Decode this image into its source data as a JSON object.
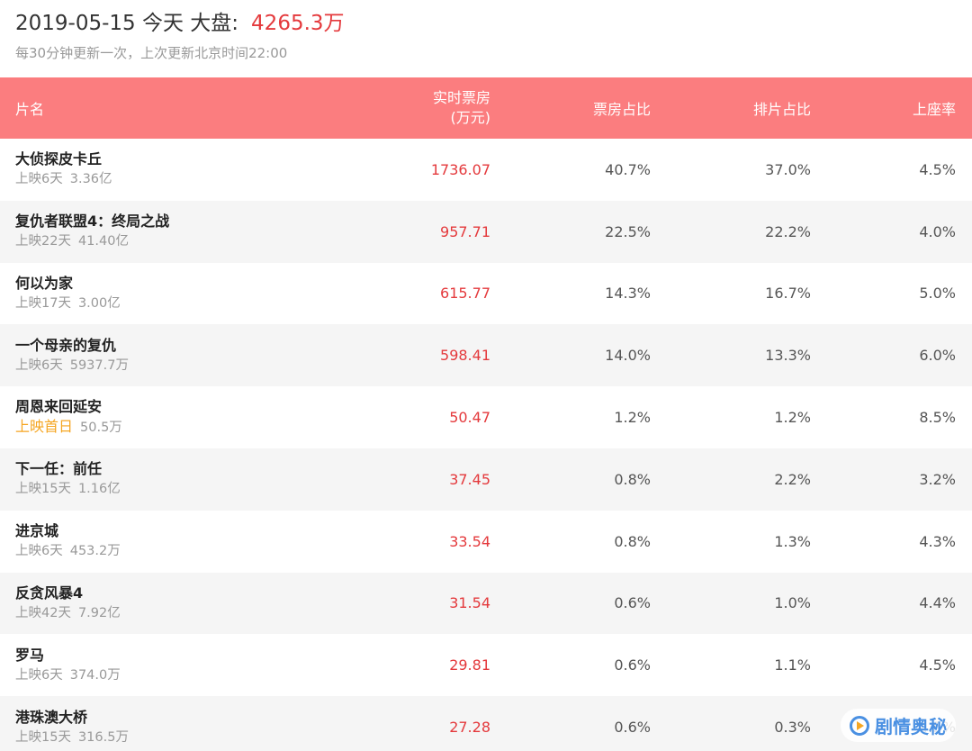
{
  "header": {
    "date_label": "2019-05-15 今天 大盘:",
    "total": "4265.3万",
    "update_note": "每30分钟更新一次，上次更新北京时间22:00"
  },
  "table": {
    "columns": {
      "name": "片名",
      "realtime_line1": "实时票房",
      "realtime_line2": "(万元)",
      "box_share": "票房占比",
      "show_share": "排片占比",
      "occupancy": "上座率"
    },
    "rows": [
      {
        "name": "大侦探皮卡丘",
        "days": "上映6天",
        "total": "3.36亿",
        "realtime": "1736.07",
        "box_share": "40.7%",
        "show_share": "37.0%",
        "occupancy": "4.5%"
      },
      {
        "name": "复仇者联盟4：终局之战",
        "days": "上映22天",
        "total": "41.40亿",
        "realtime": "957.71",
        "box_share": "22.5%",
        "show_share": "22.2%",
        "occupancy": "4.0%"
      },
      {
        "name": "何以为家",
        "days": "上映17天",
        "total": "3.00亿",
        "realtime": "615.77",
        "box_share": "14.3%",
        "show_share": "16.7%",
        "occupancy": "5.0%"
      },
      {
        "name": "一个母亲的复仇",
        "days": "上映6天",
        "total": "5937.7万",
        "realtime": "598.41",
        "box_share": "14.0%",
        "show_share": "13.3%",
        "occupancy": "6.0%"
      },
      {
        "name": "周恩来回延安",
        "days": "上映首日",
        "total": "50.5万",
        "realtime": "50.47",
        "box_share": "1.2%",
        "show_share": "1.2%",
        "occupancy": "8.5%"
      },
      {
        "name": "下一任：前任",
        "days": "上映15天",
        "total": "1.16亿",
        "realtime": "37.45",
        "box_share": "0.8%",
        "show_share": "2.2%",
        "occupancy": "3.2%"
      },
      {
        "name": "进京城",
        "days": "上映6天",
        "total": "453.2万",
        "realtime": "33.54",
        "box_share": "0.8%",
        "show_share": "1.3%",
        "occupancy": "4.3%"
      },
      {
        "name": "反贪风暴4",
        "days": "上映42天",
        "total": "7.92亿",
        "realtime": "31.54",
        "box_share": "0.6%",
        "show_share": "1.0%",
        "occupancy": "4.4%"
      },
      {
        "name": "罗马",
        "days": "上映6天",
        "total": "374.0万",
        "realtime": "29.81",
        "box_share": "0.6%",
        "show_share": "1.1%",
        "occupancy": "4.5%"
      },
      {
        "name": "港珠澳大桥",
        "days": "上映15天",
        "total": "316.5万",
        "realtime": "27.28",
        "box_share": "0.6%",
        "show_share": "0.3%",
        "occupancy": "4.5%"
      }
    ]
  },
  "watermark": {
    "text": "剧情奥秘",
    "icon": "play-circle-icon"
  },
  "colors": {
    "header_bg": "#fb7d7f",
    "accent_red": "#e4393c",
    "first_day_orange": "#f5a623",
    "row_alt_bg": "#f5f5f5",
    "watermark_blue": "#4a90e2"
  }
}
